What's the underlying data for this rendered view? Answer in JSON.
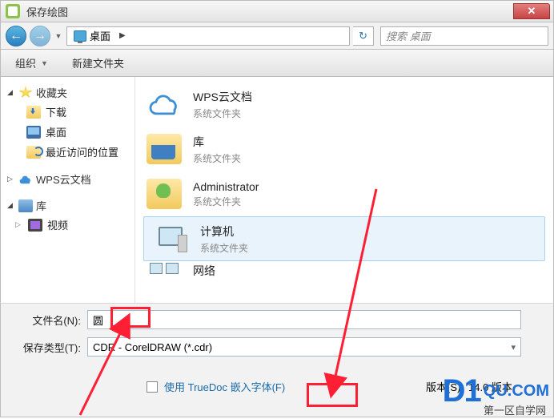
{
  "window": {
    "title": "保存绘图",
    "close_glyph": "✕"
  },
  "path": {
    "location_label": "桌面",
    "arrow": "▶",
    "search_placeholder": "搜索 桌面"
  },
  "toolbar": {
    "organize": "组织",
    "new_folder": "新建文件夹"
  },
  "nav": {
    "favorites": "收藏夹",
    "downloads": "下载",
    "desktop": "桌面",
    "recent": "最近访问的位置",
    "wps_cloud": "WPS云文档",
    "libraries": "库",
    "videos": "视频"
  },
  "content": {
    "sys_folder": "系统文件夹",
    "items": [
      {
        "title": "WPS云文档"
      },
      {
        "title": "库"
      },
      {
        "title": "Administrator"
      },
      {
        "title": "计算机"
      },
      {
        "title": "网络"
      }
    ]
  },
  "fields": {
    "filename_label": "文件名(N):",
    "filename_value": "圆",
    "filetype_label": "保存类型(T):",
    "filetype_value": "CDR - CorelDRAW (*.cdr)",
    "truedoc_label": "使用 TrueDoc 嵌入字体(F)",
    "version_label": "版本(S):",
    "version_value": "14.0 版本"
  },
  "watermark": {
    "logo": "D1",
    "domain": "QU.COM",
    "sub": "第一区自学网"
  }
}
